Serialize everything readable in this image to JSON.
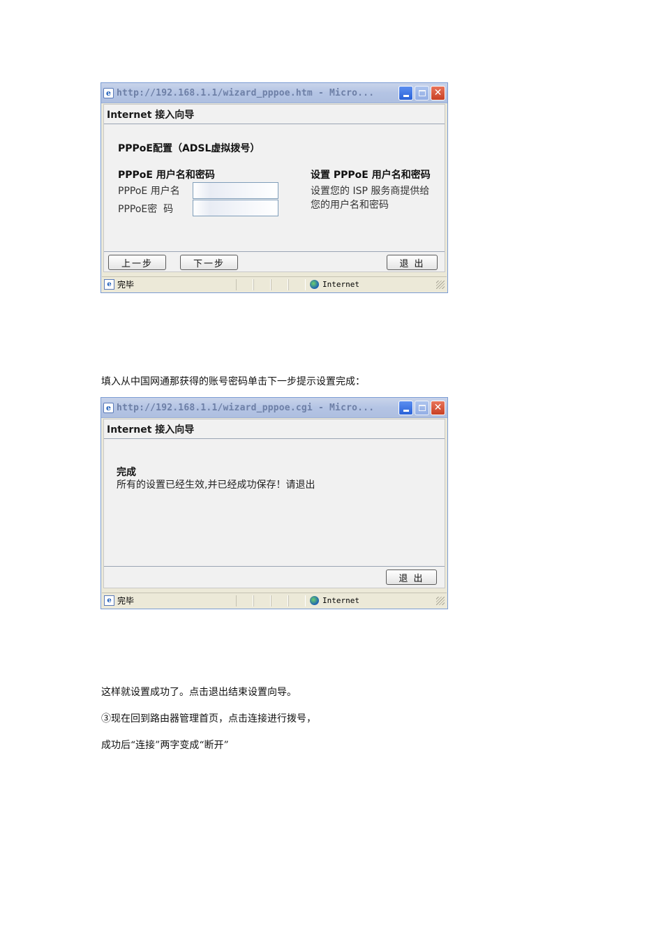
{
  "window1": {
    "title": "http://192.168.1.1/wizard_pppoe.htm - Micro...",
    "header": "Internet 接入向导",
    "section_title": "PPPoE配置（ADSL虚拟拨号）",
    "form_title": "PPPoE 用户名和密码",
    "username_label": "PPPoE 用户名",
    "password_label": "PPPoE密  码",
    "help_title": "设置  PPPoE 用户名和密码",
    "help_line1": "设置您的  ISP 服务商提供给",
    "help_line2": "您的用户名和密码",
    "prev_button": "上一步",
    "next_button": "下一步",
    "exit_button": "退 出",
    "status_text": "完毕",
    "status_zone": "Internet"
  },
  "caption1": "填入从中国网通那获得的账号密码单击下一步提示设置完成：",
  "window2": {
    "title": "http://192.168.1.1/wizard_pppoe.cgi - Micro...",
    "header": "Internet 接入向导",
    "done_title": "完成",
    "done_message": "所有的设置已经生效,并已经成功保存！请退出",
    "exit_button": "退 出",
    "status_text": "完毕",
    "status_zone": "Internet"
  },
  "paragraphs": {
    "p1": "这样就设置成功了。点击退出结束设置向导。",
    "p2": "③现在回到路由器管理首页，点击连接进行拨号，",
    "p3": "成功后“连接”两字变成“断开”"
  },
  "colors": {
    "titlebar": "#b4c4e4",
    "close_button": "#c84024",
    "content_bg": "#f1f1f1"
  }
}
